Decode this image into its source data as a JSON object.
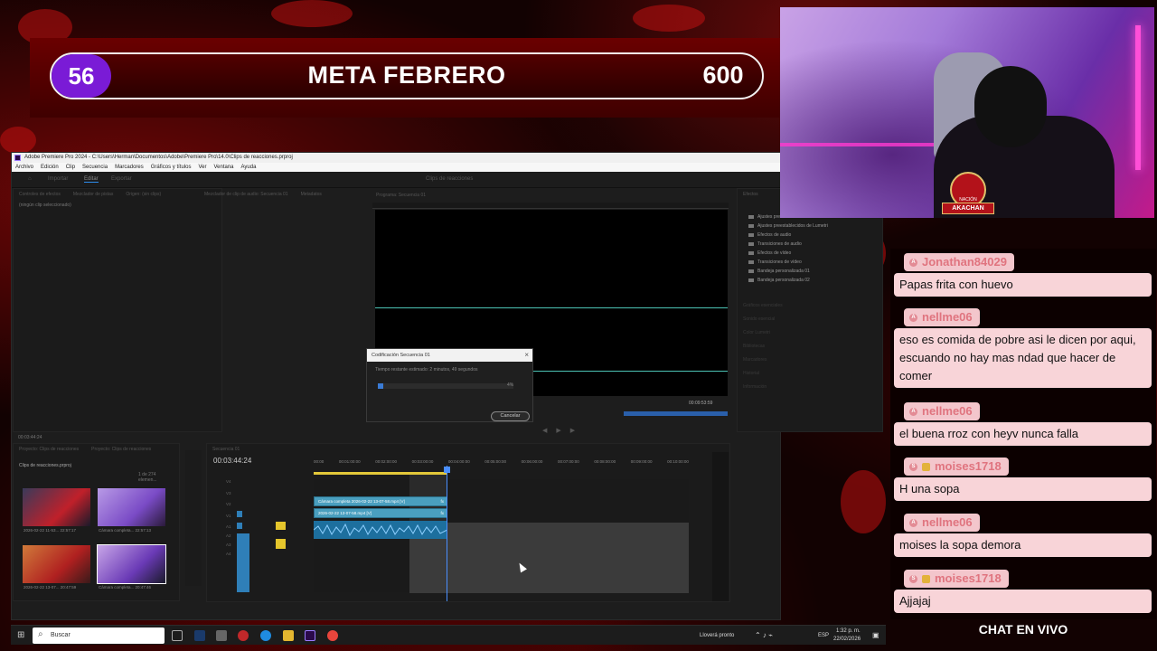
{
  "goal": {
    "current": "56",
    "title": "META FEBRERO",
    "target": "600",
    "accent": "#7a1bd6"
  },
  "premiere": {
    "title": "Adobe Premiere Pro 2024 - C:\\Users\\Herman\\Documentos\\Adobe\\Premiere Pro\\14.0\\Clips de reacciones.prproj",
    "menu": [
      "Archivo",
      "Edición",
      "Clip",
      "Secuencia",
      "Marcadores",
      "Gráficos y títulos",
      "Ver",
      "Ventana",
      "Ayuda"
    ],
    "workspace_tabs": [
      "Importar",
      "Editar",
      "Exportar"
    ],
    "workspace_center": "Clips de reacciones",
    "source_panel": {
      "tabs": [
        "Controles de efectos",
        "Mezclador de pistas",
        "Origen: (sin clips)",
        "Mezclador de clip de audio: Secuencia 01",
        "Metadatos"
      ],
      "empty_text": "(ningún clip seleccionado)",
      "timecode": "00:03:44:24"
    },
    "program": {
      "tab": "Programa: Secuencia 01",
      "duration": "00:09:53:59"
    },
    "effects": {
      "tab": "Efectos",
      "items": [
        "Ajustes preestablecidos",
        "Ajustes preestablecidos de Lumetri",
        "Efectos de audio",
        "Transiciones de audio",
        "Efectos de vídeo",
        "Transiciones de vídeo",
        "Bandeja personalizada 01",
        "Bandeja personalizada 02"
      ],
      "dim_items": [
        "Gráficos esenciales",
        "Sonido esencial",
        "Color Lumetri",
        "Bibliotecas",
        "Marcadores",
        "Historial",
        "Información"
      ]
    },
    "dialog": {
      "title": "Codificación Secuencia 01",
      "message": "Tiempo restante estimado: 2 minutos, 49 segundos",
      "percent_label": "4%",
      "progress": 0.04,
      "cancel_label": "Cancelar"
    },
    "project": {
      "tabs": [
        "Proyecto: Clips de reacciones",
        "Proyecto: Clips de reacciones"
      ],
      "name": "Clips de reacciones.prproj",
      "count": "1 de 274 elemen...",
      "items": [
        {
          "label": "2026-02-22 11-53...",
          "dur": "22:57:17"
        },
        {
          "label": "Cámara completa...",
          "dur": "22:57:13"
        },
        {
          "label": "2026-02-22 13-07...",
          "dur": "20:47:59"
        },
        {
          "label": "Cámara completa...",
          "dur": "20:47:46"
        }
      ]
    },
    "timeline": {
      "tab": "Secuencia 01",
      "timecode": "00:03:44:24",
      "ruler": [
        "00:00",
        "00:01:00:00",
        "00:02:00:00",
        "00:03:00:00",
        "00:04:00:00",
        "00:05:00:00",
        "00:06:00:00",
        "00:07:00:00",
        "00:08:00:00",
        "00:09:00:00",
        "00:10:00:00"
      ],
      "tracks_v": [
        "V4",
        "V3",
        "V2",
        "V1"
      ],
      "tracks_a": [
        "A1",
        "A2",
        "A3",
        "A4"
      ],
      "clip_v2": "Cámara completa 2026-02-22 13-07-58.mp4 [V]",
      "clip_v1": "2026-02-22 13-07-58.mp4 [V]",
      "clip_fx": "fx"
    }
  },
  "chat": {
    "messages": [
      {
        "user": "Jonathan84029",
        "text": "Papas frita con huevo",
        "badge": "A"
      },
      {
        "user": "nellme06",
        "text": "eso es comida de pobre asi le dicen por aqui, escuando no hay mas ndad que hacer de comer",
        "badge": "A"
      },
      {
        "user": "nellme06",
        "text": "el buena rroz con heyv nunca falla",
        "badge": "A"
      },
      {
        "user": "moises1718",
        "text": "H una sopa",
        "badge": "S"
      },
      {
        "user": "nellme06",
        "text": "moises la sopa demora",
        "badge": "A"
      },
      {
        "user": "moises1718",
        "text": "Ajjajaj",
        "badge": "S"
      }
    ],
    "footer": "CHAT EN VIVO",
    "name_color": "#e0747f",
    "bubble_color": "#f8d4d8"
  },
  "badge": {
    "top": "NACIÓN",
    "name": "AKACHAN"
  },
  "taskbar": {
    "search_placeholder": "Buscar",
    "weather": "Lloverá pronto",
    "lang": "ESP",
    "time": "1:32 p. m.",
    "date": "22/02/2026"
  }
}
